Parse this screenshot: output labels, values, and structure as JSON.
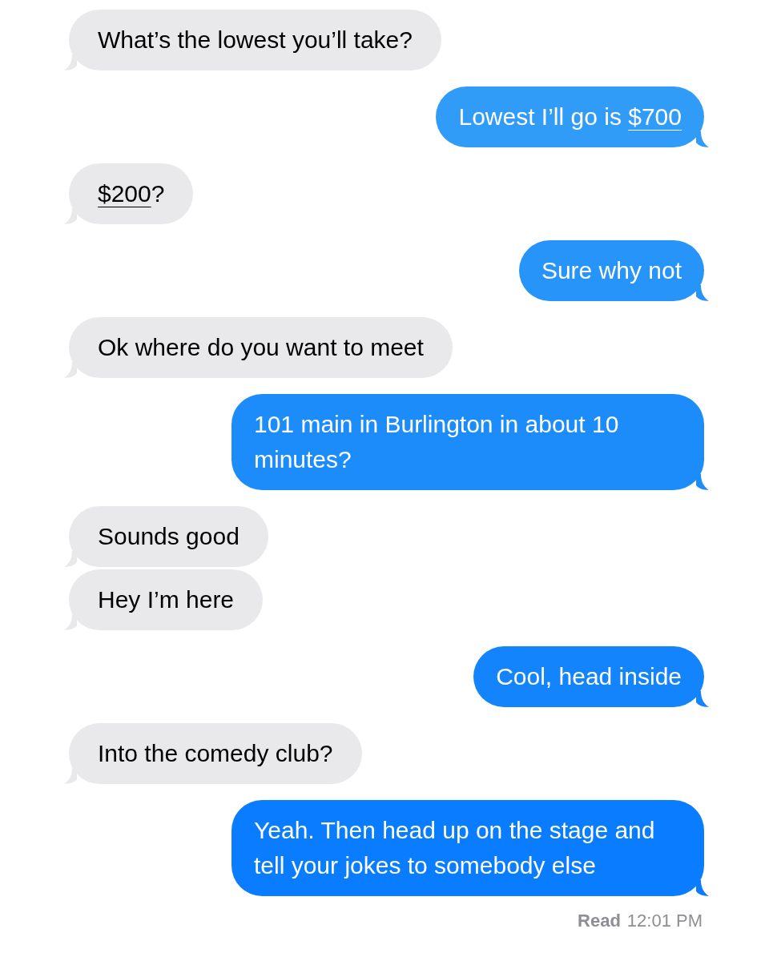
{
  "messages": [
    {
      "kind": "them",
      "parts": [
        {
          "text": "What’s the lowest you’ll take?"
        }
      ]
    },
    {
      "kind": "me",
      "parts": [
        {
          "text": "Lowest I’ll go is "
        },
        {
          "text": "$700",
          "link": true
        }
      ]
    },
    {
      "kind": "them",
      "parts": [
        {
          "text": "$200",
          "link": true
        },
        {
          "text": "?"
        }
      ]
    },
    {
      "kind": "me",
      "parts": [
        {
          "text": "Sure why not"
        }
      ]
    },
    {
      "kind": "them",
      "parts": [
        {
          "text": "Ok where do you want to meet"
        }
      ]
    },
    {
      "kind": "me",
      "parts": [
        {
          "text": "101 main in Burlington in about 10 minutes?"
        }
      ]
    },
    {
      "kind": "them",
      "parts": [
        {
          "text": "Sounds good"
        }
      ]
    },
    {
      "kind": "them",
      "parts": [
        {
          "text": "Hey I’m here"
        }
      ]
    },
    {
      "kind": "me",
      "parts": [
        {
          "text": "Cool, head inside"
        }
      ]
    },
    {
      "kind": "them",
      "parts": [
        {
          "text": "Into the comedy club?"
        }
      ]
    },
    {
      "kind": "me",
      "parts": [
        {
          "text": "Yeah. Then head up on the stage and tell your jokes to somebody else"
        }
      ]
    }
  ],
  "receipt": {
    "label": "Read",
    "time": "12:01 PM"
  }
}
